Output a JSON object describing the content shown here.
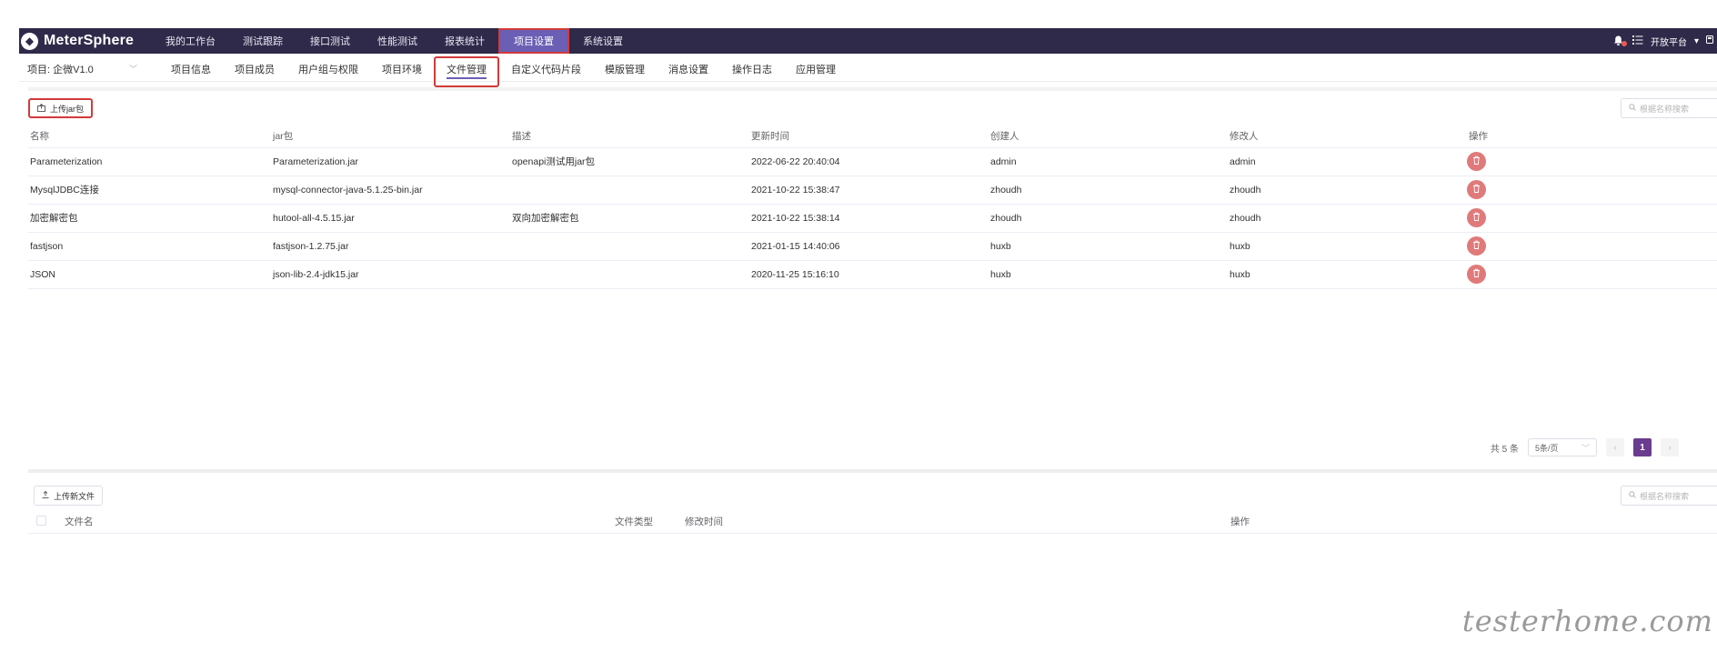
{
  "app": {
    "name": "MeterSphere",
    "logo_glyph": "◆"
  },
  "topnav": {
    "items": [
      {
        "label": "我的工作台",
        "active": false
      },
      {
        "label": "测试跟踪",
        "active": false
      },
      {
        "label": "接口测试",
        "active": false
      },
      {
        "label": "性能测试",
        "active": false
      },
      {
        "label": "报表统计",
        "active": false
      },
      {
        "label": "项目设置",
        "active": true
      },
      {
        "label": "系统设置",
        "active": false
      }
    ],
    "workspace": "开放平台"
  },
  "subnav": {
    "project": "项目: 企微V1.0",
    "items": [
      {
        "label": "项目信息",
        "active": false
      },
      {
        "label": "项目成员",
        "active": false
      },
      {
        "label": "用户组与权限",
        "active": false
      },
      {
        "label": "项目环境",
        "active": false
      },
      {
        "label": "文件管理",
        "active": true
      },
      {
        "label": "自定义代码片段",
        "active": false
      },
      {
        "label": "模版管理",
        "active": false
      },
      {
        "label": "消息设置",
        "active": false
      },
      {
        "label": "操作日志",
        "active": false
      },
      {
        "label": "应用管理",
        "active": false
      }
    ]
  },
  "jar_panel": {
    "upload_label": "上传jar包",
    "search_placeholder": "根据名称搜索",
    "columns": [
      "名称",
      "jar包",
      "描述",
      "更新时间",
      "创建人",
      "修改人",
      "操作"
    ],
    "rows": [
      {
        "name": "Parameterization",
        "jar": "Parameterization.jar",
        "desc": "openapi测试用jar包",
        "updated": "2022-06-22 20:40:04",
        "creator": "admin",
        "modifier": "admin"
      },
      {
        "name": "MysqlJDBC连接",
        "jar": "mysql-connector-java-5.1.25-bin.jar",
        "desc": "",
        "updated": "2021-10-22 15:38:47",
        "creator": "zhoudh",
        "modifier": "zhoudh"
      },
      {
        "name": "加密解密包",
        "jar": "hutool-all-4.5.15.jar",
        "desc": "双向加密解密包",
        "updated": "2021-10-22 15:38:14",
        "creator": "zhoudh",
        "modifier": "zhoudh"
      },
      {
        "name": "fastjson",
        "jar": "fastjson-1.2.75.jar",
        "desc": "",
        "updated": "2021-01-15 14:40:06",
        "creator": "huxb",
        "modifier": "huxb"
      },
      {
        "name": "JSON",
        "jar": "json-lib-2.4-jdk15.jar",
        "desc": "",
        "updated": "2020-11-25 15:16:10",
        "creator": "huxb",
        "modifier": "huxb"
      }
    ],
    "pagination": {
      "total": "共 5 条",
      "page_size": "5条/页",
      "current": "1"
    }
  },
  "file_panel": {
    "upload_label": "上传新文件",
    "search_placeholder": "根据名称搜索",
    "columns": {
      "name": "文件名",
      "type": "文件类型",
      "modified": "修改时间",
      "action": "操作"
    }
  },
  "watermark": "testerhome.com",
  "colors": {
    "topbar": "#2f2a4a",
    "accent": "#6a5fb5",
    "highlight": "#d23a3a",
    "delete": "#e07a7a",
    "page_active": "#6a3c8f"
  }
}
